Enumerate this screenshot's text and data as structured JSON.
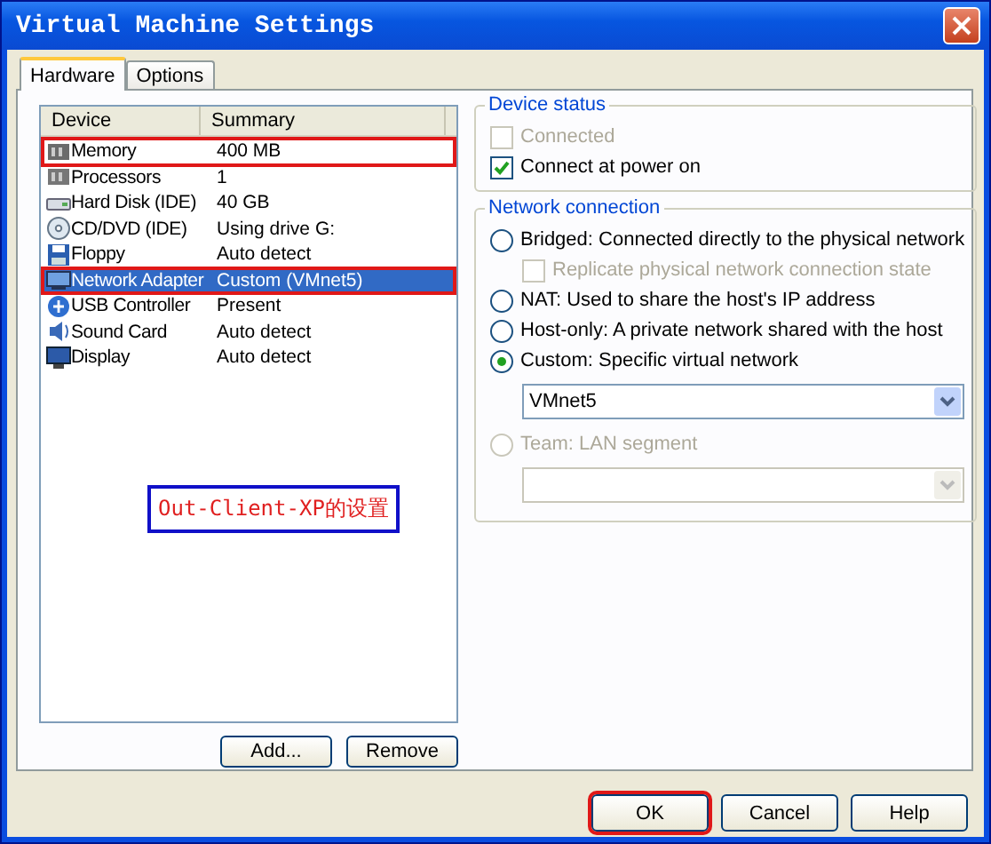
{
  "window": {
    "title": "Virtual Machine Settings"
  },
  "tabs": [
    {
      "label": "Hardware",
      "selected": true
    },
    {
      "label": "Options",
      "selected": false
    }
  ],
  "device_list": {
    "columns": [
      "Device",
      "Summary"
    ],
    "rows": [
      {
        "kind": "memory",
        "device": "Memory",
        "summary": "400 MB",
        "selected": false,
        "highlighted": true
      },
      {
        "kind": "processor",
        "device": "Processors",
        "summary": "1",
        "selected": false,
        "highlighted": false
      },
      {
        "kind": "disk",
        "device": "Hard Disk (IDE)",
        "summary": "40 GB",
        "selected": false,
        "highlighted": false
      },
      {
        "kind": "cd",
        "device": "CD/DVD (IDE)",
        "summary": "Using drive G:",
        "selected": false,
        "highlighted": false
      },
      {
        "kind": "floppy",
        "device": "Floppy",
        "summary": "Auto detect",
        "selected": false,
        "highlighted": false
      },
      {
        "kind": "network",
        "device": "Network Adapter",
        "summary": "Custom (VMnet5)",
        "selected": true,
        "highlighted": true
      },
      {
        "kind": "usb",
        "device": "USB Controller",
        "summary": "Present",
        "selected": false,
        "highlighted": false
      },
      {
        "kind": "sound",
        "device": "Sound Card",
        "summary": "Auto detect",
        "selected": false,
        "highlighted": false
      },
      {
        "kind": "display",
        "device": "Display",
        "summary": "Auto detect",
        "selected": false,
        "highlighted": false
      }
    ]
  },
  "annotation": "Out-Client-XP的设置",
  "list_buttons": [
    {
      "label": "Add...",
      "highlighted": false
    },
    {
      "label": "Remove",
      "highlighted": false
    }
  ],
  "device_status": {
    "title": "Device status",
    "checkboxes": [
      {
        "label": "Connected",
        "checked": false,
        "disabled": true
      },
      {
        "label": "Connect at power on",
        "checked": true,
        "disabled": false
      }
    ]
  },
  "network_connection": {
    "title": "Network connection",
    "options": [
      {
        "label": "Bridged: Connected directly to the physical network",
        "selected": false,
        "disabled": false,
        "checkbox": {
          "label": "Replicate physical network connection state",
          "checked": false,
          "disabled": true
        }
      },
      {
        "label": "NAT: Used to share the host's IP address",
        "selected": false,
        "disabled": false
      },
      {
        "label": "Host-only: A private network shared with the host",
        "selected": false,
        "disabled": false
      },
      {
        "label": "Custom: Specific virtual network",
        "selected": true,
        "disabled": false,
        "dropdown": {
          "value": "VMnet5",
          "disabled": false
        }
      },
      {
        "label": "Team: LAN segment",
        "selected": false,
        "disabled": true,
        "dropdown": {
          "disabled": true
        }
      }
    ]
  },
  "dialog_buttons": [
    {
      "label": "OK",
      "highlighted": true
    },
    {
      "label": "Cancel",
      "highlighted": false
    },
    {
      "label": "Help",
      "highlighted": false
    }
  ]
}
